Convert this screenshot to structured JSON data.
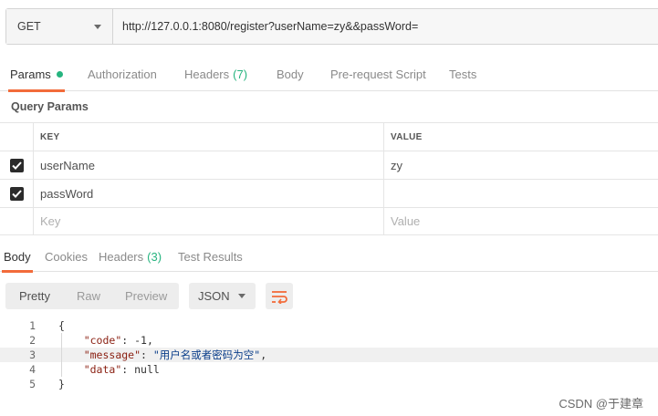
{
  "request": {
    "method": "GET",
    "url": "http://127.0.0.1:8080/register?userName=zy&&passWord="
  },
  "request_tabs": [
    {
      "label": "Params",
      "active": true,
      "dot": true
    },
    {
      "label": "Authorization"
    },
    {
      "label": "Headers",
      "count": "(7)"
    },
    {
      "label": "Body"
    },
    {
      "label": "Pre-request Script"
    },
    {
      "label": "Tests"
    }
  ],
  "query_params": {
    "title": "Query Params",
    "columns": {
      "key": "KEY",
      "value": "VALUE"
    },
    "rows": [
      {
        "checked": true,
        "key": "userName",
        "value": "zy"
      },
      {
        "checked": true,
        "key": "passWord",
        "value": ""
      }
    ],
    "new_row": {
      "key_placeholder": "Key",
      "value_placeholder": "Value"
    }
  },
  "response_tabs": [
    {
      "label": "Body",
      "active": true
    },
    {
      "label": "Cookies"
    },
    {
      "label": "Headers",
      "count": "(3)"
    },
    {
      "label": "Test Results"
    }
  ],
  "response_toolbar": {
    "views": [
      "Pretty",
      "Raw",
      "Preview"
    ],
    "active_view": "Pretty",
    "format": "JSON"
  },
  "response_body": {
    "line_numbers": [
      "1",
      "2",
      "3",
      "4",
      "5"
    ],
    "lines": [
      {
        "open": "{"
      },
      {
        "key": "\"code\"",
        "value": "-1",
        "suffix": ","
      },
      {
        "key": "\"message\"",
        "value": "\"用户名或者密码为空\"",
        "suffix": ","
      },
      {
        "key": "\"data\"",
        "value": "null",
        "suffix": ""
      },
      {
        "close": "}"
      }
    ]
  },
  "watermark": "CSDN @于建章",
  "colors": {
    "accent": "#f26b3a",
    "success": "#26b47f"
  },
  "icons": [
    "chevron-down-icon",
    "checkbox-checked-icon",
    "wrap-lines-icon"
  ]
}
